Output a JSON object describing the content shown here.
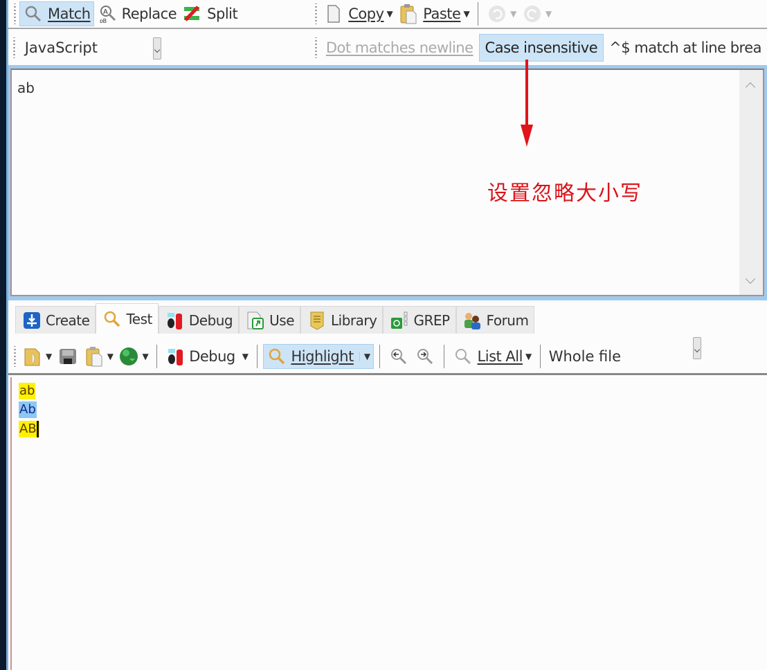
{
  "toolbar_main": {
    "match": "Match",
    "replace": "Replace",
    "split": "Split",
    "copy": "Copy",
    "paste": "Paste"
  },
  "toolbar_options": {
    "flavor": "JavaScript",
    "dot_matches_newline": "Dot matches newline",
    "case_insensitive": "Case insensitive",
    "caret_dollar": "^$ match at line brea"
  },
  "regex": {
    "value": "ab"
  },
  "annotation": {
    "text": "设置忽略大小写",
    "color": "#d9141a"
  },
  "tabs": [
    {
      "label": "Create"
    },
    {
      "label": "Test"
    },
    {
      "label": "Debug"
    },
    {
      "label": "Use"
    },
    {
      "label": "Library"
    },
    {
      "label": "GREP"
    },
    {
      "label": "Forum"
    }
  ],
  "test_toolbar": {
    "debug": "Debug",
    "highlight": "Highlight",
    "list_all": "List All",
    "scope": "Whole file"
  },
  "test_subject": {
    "lines": [
      {
        "text": "ab",
        "highlight": "yellow"
      },
      {
        "text": "Ab",
        "highlight": "blue"
      },
      {
        "text": "AB",
        "highlight": "yellow"
      }
    ]
  },
  "colors": {
    "highlight_yellow": "#fff200",
    "highlight_blue": "#8cc8f5",
    "active_button": "#cde4f7",
    "selection_border": "#9ccbef"
  }
}
